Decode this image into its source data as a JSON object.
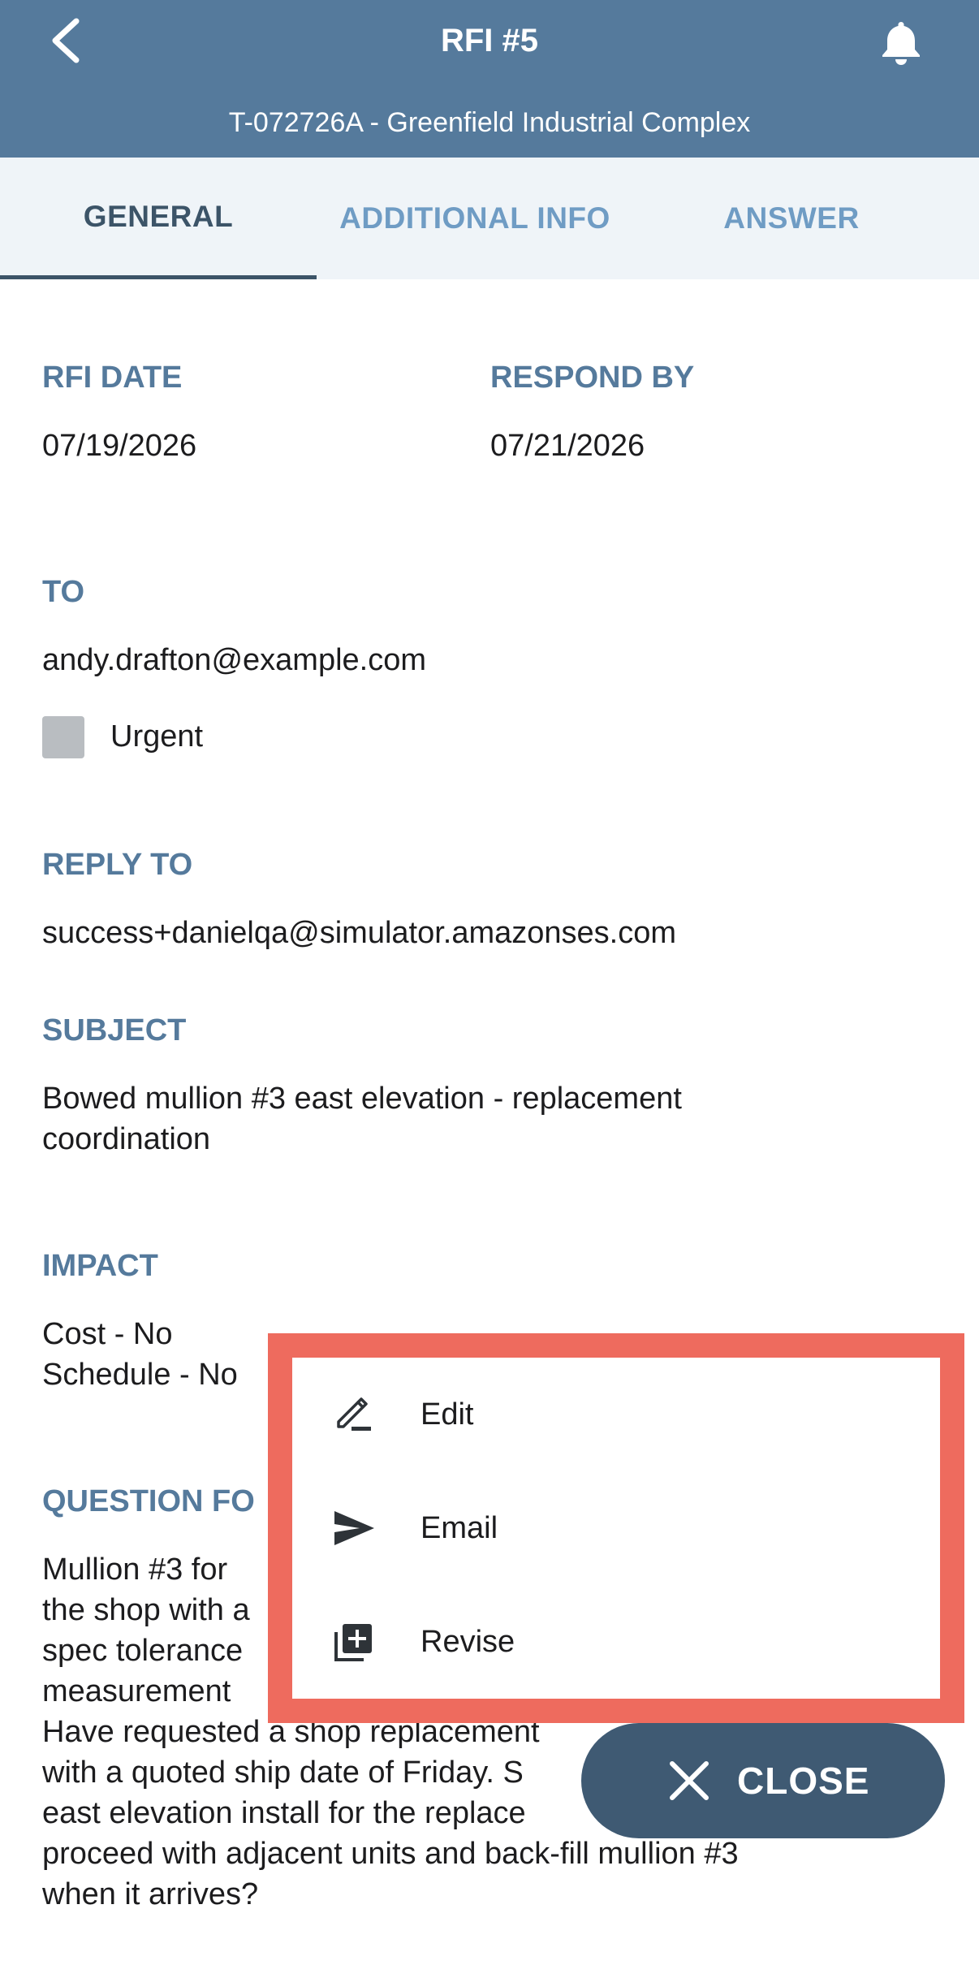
{
  "header": {
    "title": "RFI #5",
    "subtitle": "T-072726A - Greenfield Industrial Complex"
  },
  "tabs": [
    {
      "label": "GENERAL",
      "active": true
    },
    {
      "label": "ADDITIONAL INFO",
      "active": false
    },
    {
      "label": "ANSWER",
      "active": false
    }
  ],
  "general": {
    "rfi_date_label": "RFI DATE",
    "rfi_date": "07/19/2026",
    "respond_by_label": "RESPOND BY",
    "respond_by": "07/21/2026",
    "to_label": "TO",
    "to": "andy.drafton@example.com",
    "urgent_label": "Urgent",
    "urgent_checked": false,
    "reply_to_label": "REPLY TO",
    "reply_to": "success+danielqa@simulator.amazonses.com",
    "subject_label": "SUBJECT",
    "subject_line1": "Bowed mullion #3 east elevation - replacement",
    "subject_line2": "coordination",
    "impact_label": "IMPACT",
    "impact_cost": "Cost - No",
    "impact_schedule": "Schedule - No",
    "question_label": "QUESTION FO",
    "question_lines": [
      "Mullion #3 for",
      "the shop with a",
      "spec tolerance",
      "measurement",
      "Have requested a shop replacement",
      "with a quoted ship date of Friday. S",
      "east elevation install for the replace",
      "proceed with adjacent units and back-fill mullion #3",
      "when it arrives?"
    ]
  },
  "menu": {
    "items": [
      {
        "label": "Edit",
        "icon": "edit-pencil-icon"
      },
      {
        "label": "Email",
        "icon": "send-icon"
      },
      {
        "label": "Revise",
        "icon": "add-copy-icon"
      }
    ]
  },
  "fab": {
    "close_label": "CLOSE"
  },
  "colors": {
    "header_bg": "#557a9c",
    "tab_bg": "#eff4f8",
    "tab_active": "#3c5468",
    "tab_inactive": "#6f9cc4",
    "label_blue": "#557a9c",
    "menu_highlight": "#ee6b5e",
    "fab_bg": "#3f5a73"
  }
}
